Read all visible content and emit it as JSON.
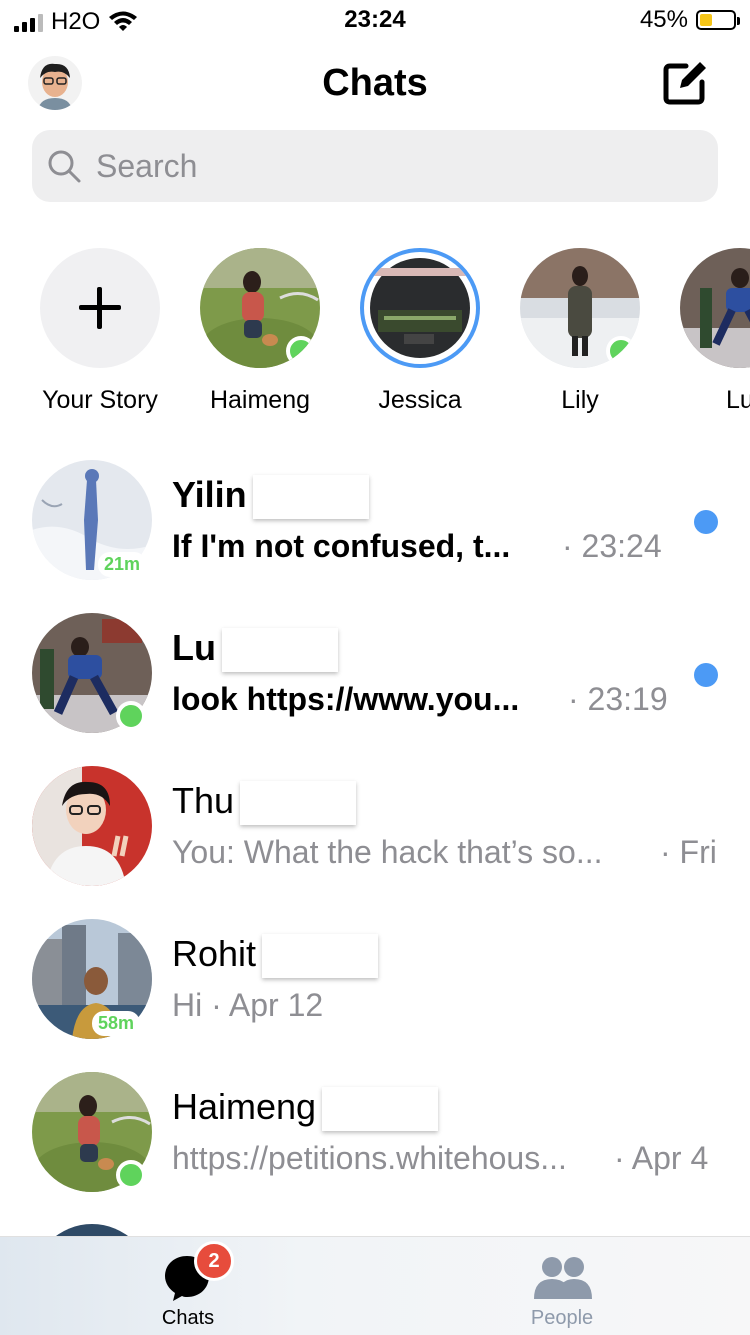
{
  "status_bar": {
    "carrier": "H2O",
    "time": "23:24",
    "battery": "45%",
    "battery_level": 0.45
  },
  "header": {
    "title": "Chats"
  },
  "search": {
    "placeholder": "Search"
  },
  "stories": [
    {
      "label": "Your Story"
    },
    {
      "label": "Haimeng"
    },
    {
      "label": "Jessica"
    },
    {
      "label": "Lily"
    },
    {
      "label": "Lu"
    }
  ],
  "chats": [
    {
      "name": "Yilin",
      "message": "If I'm not confused, t...",
      "time": "· 23:24",
      "active_ago": "21m"
    },
    {
      "name": "Lu",
      "message": "look https://www.you...",
      "time": "· 23:19"
    },
    {
      "name": "Thu",
      "message": "You: What the hack that’s so...",
      "time": "· Fri"
    },
    {
      "name": "Rohit",
      "message": "Hi · Apr 12",
      "active_ago": "58m"
    },
    {
      "name": "Haimeng",
      "message": "https://petitions.whitehous...",
      "time": "· Apr 4"
    }
  ],
  "tabbar": {
    "chats_label": "Chats",
    "chats_badge": "2",
    "people_label": "People"
  },
  "colors": {
    "online": "#5fd35c",
    "unread": "#4c9af5",
    "badge": "#e74c3c",
    "story_ring": "#4c9af5"
  }
}
